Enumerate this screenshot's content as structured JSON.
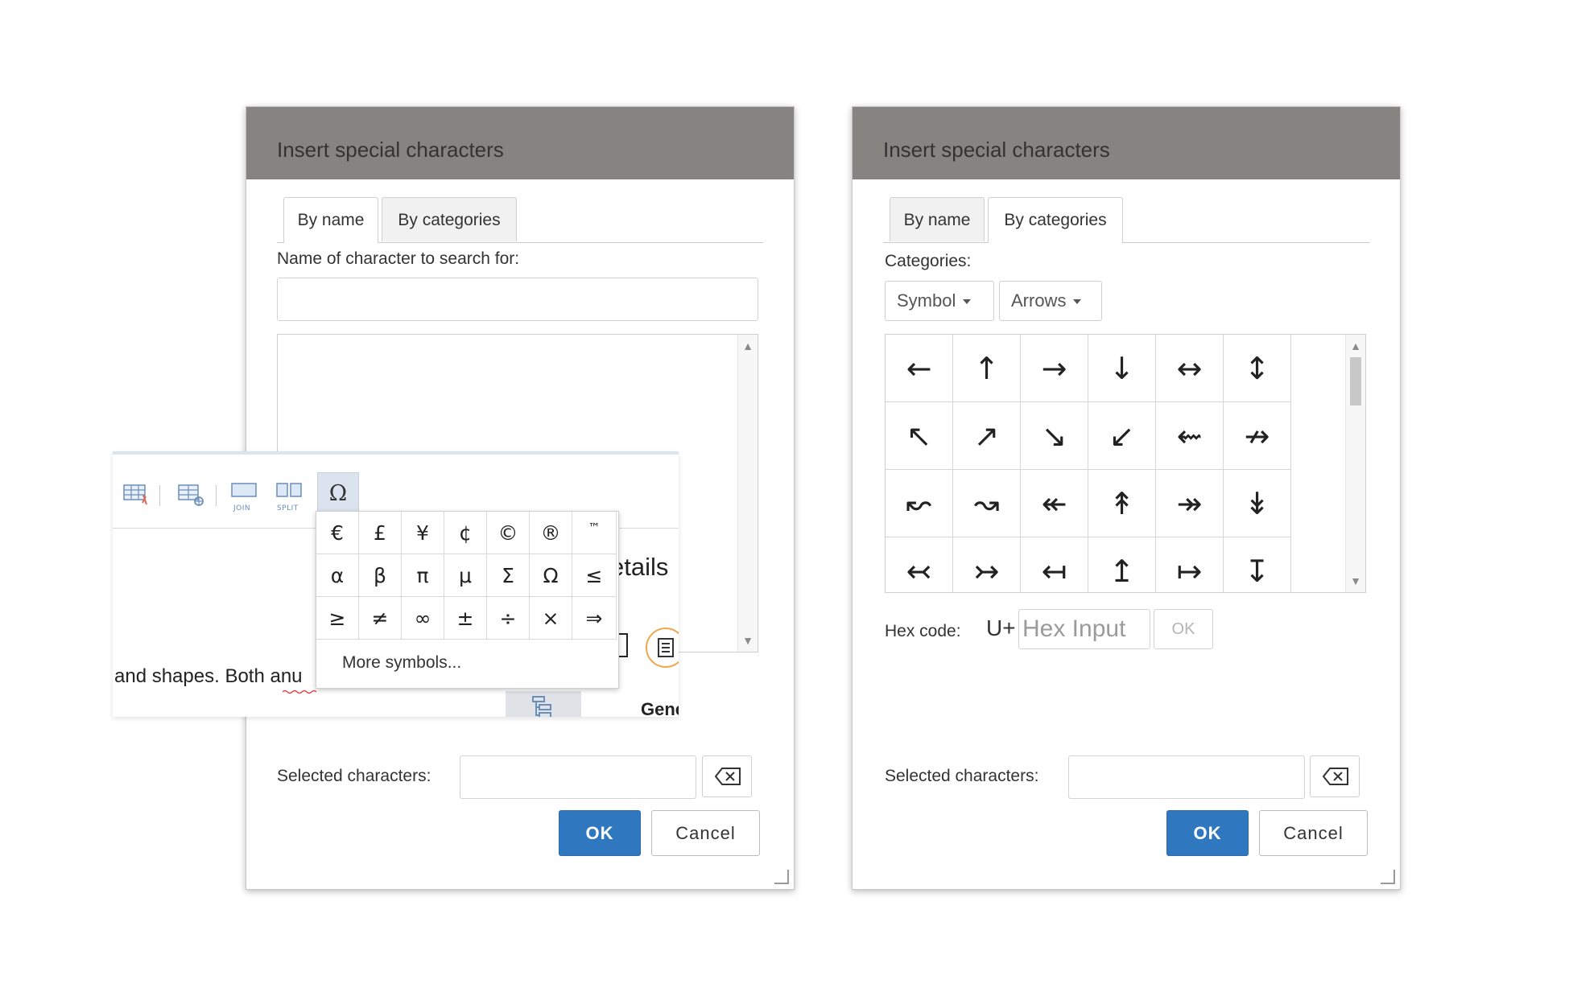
{
  "dialog_left": {
    "title": "Insert special characters",
    "tabs": [
      {
        "label": "By name",
        "active": true
      },
      {
        "label": "By categories",
        "active": false
      }
    ],
    "search_label": "Name of character to search for:",
    "search_value": "",
    "selected_label": "Selected characters:",
    "selected_value": "",
    "ok_label": "OK",
    "cancel_label": "Cancel"
  },
  "dialog_right": {
    "title": "Insert special characters",
    "tabs": [
      {
        "label": "By name",
        "active": false
      },
      {
        "label": "By categories",
        "active": true
      }
    ],
    "categories_label": "Categories:",
    "category_select": "Symbol",
    "subcategory_select": "Arrows",
    "chars": [
      "←",
      "↑",
      "→",
      "↓",
      "↔",
      "↕",
      "↖",
      "↗",
      "↘",
      "↙",
      "⇜",
      "↛",
      "↜",
      "↝",
      "↞",
      "↟",
      "↠",
      "↡",
      "↢",
      "↣",
      "↤",
      "↥",
      "↦",
      "↧"
    ],
    "hex_label": "Hex code:",
    "hex_prefix": "U+",
    "hex_placeholder": "Hex Input",
    "hex_ok_label": "OK",
    "selected_label": "Selected characters:",
    "selected_value": "",
    "ok_label": "OK",
    "cancel_label": "Cancel"
  },
  "editor_popup": {
    "toolbar": {
      "join_caption": "JOIN",
      "split_caption": "SPLIT",
      "omega_label": "Ω"
    },
    "symbol_menu": {
      "symbols": [
        "€",
        "£",
        "¥",
        "¢",
        "©",
        "®",
        "™",
        "α",
        "β",
        "π",
        "μ",
        "Σ",
        "Ω",
        "≤",
        "≥",
        "≠",
        "∞",
        "±",
        "÷",
        "×",
        "⇒"
      ],
      "more_label": "More symbols..."
    },
    "doc_text_left": "and shapes. Both anu",
    "doc_text_right": "etails",
    "doc_text_bottom": "Gene"
  },
  "colors": {
    "header_bg": "#868480",
    "ok_bg": "#2f78bf",
    "popup_active_bg": "#dbe4ee"
  }
}
